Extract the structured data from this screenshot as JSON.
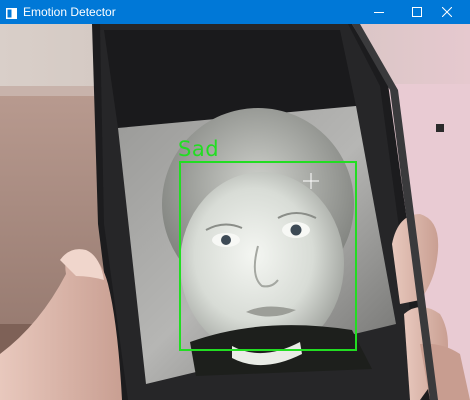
{
  "window": {
    "title": "Emotion Detector",
    "titlebar_color": "#0078d7"
  },
  "controls": {
    "minimize_icon": "minimize-icon",
    "maximize_icon": "maximize-icon",
    "close_icon": "close-icon"
  },
  "detection": {
    "label": "Sad",
    "box_color": "#22dd22"
  }
}
